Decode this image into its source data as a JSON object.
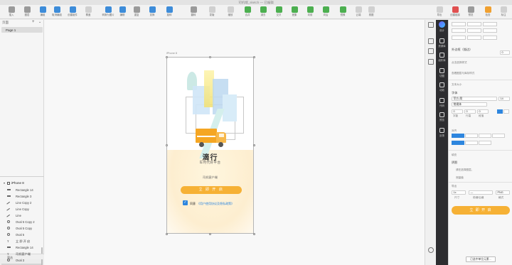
{
  "window": {
    "title": "司机端_sketch — 已编辑"
  },
  "toolbar": {
    "items": [
      {
        "label": "插入",
        "icon": "plus-icon",
        "color": "gray"
      },
      {
        "label": "图层",
        "icon": "layers-icon",
        "color": "gray"
      },
      {
        "label": "编组",
        "icon": "group-icon",
        "color": "blue"
      },
      {
        "label": "取消编组",
        "icon": "ungroup-icon",
        "color": "blue"
      },
      {
        "label": "创建组件",
        "icon": "symbol-icon",
        "color": "blue"
      },
      {
        "label": "覆盖",
        "icon": "override-icon",
        "color": "light"
      },
      {
        "label": "转换为图片",
        "icon": "image-icon",
        "color": "blue"
      },
      {
        "label": "编辑",
        "icon": "edit-icon",
        "color": "blue"
      },
      {
        "label": "重复",
        "icon": "repeat-icon",
        "color": "gray"
      },
      {
        "label": "变换",
        "icon": "transform-icon",
        "color": "blue"
      },
      {
        "label": "旋转",
        "icon": "rotate-icon",
        "color": "blue"
      },
      {
        "label": "翻转",
        "icon": "flip-icon",
        "color": "gray"
      },
      {
        "label": "蒙版",
        "icon": "mask-icon",
        "color": "light"
      },
      {
        "label": "缩放",
        "icon": "scale-icon",
        "color": "light"
      },
      {
        "label": "合并",
        "icon": "union-icon",
        "color": "green"
      },
      {
        "label": "减去",
        "icon": "subtract-icon",
        "color": "green"
      },
      {
        "label": "交叉",
        "icon": "intersect-icon",
        "color": "green"
      },
      {
        "label": "差集",
        "icon": "difference-icon",
        "color": "green"
      },
      {
        "label": "向前",
        "icon": "forward-icon",
        "color": "green"
      },
      {
        "label": "向后",
        "icon": "backward-icon",
        "color": "green"
      },
      {
        "label": "镜像",
        "icon": "mirror-icon",
        "color": "green"
      },
      {
        "label": "云端",
        "icon": "cloud-icon",
        "color": "light"
      },
      {
        "label": "视图",
        "icon": "view-icon",
        "color": "light"
      },
      {
        "label": "导出",
        "icon": "export-icon",
        "color": "light"
      },
      {
        "label": "创建链接",
        "icon": "link-icon",
        "color": "red"
      },
      {
        "label": "预览",
        "icon": "preview-icon",
        "color": "gray"
      },
      {
        "label": "检查",
        "icon": "inspect-icon",
        "color": "orange"
      },
      {
        "label": "标注",
        "icon": "annotate-icon",
        "color": "light"
      }
    ]
  },
  "left_panel": {
    "header": "页面",
    "pages": [
      "Page 1"
    ],
    "artboard": "iPhone 8",
    "layers": [
      {
        "name": "Rectangle 14",
        "kind": "rect"
      },
      {
        "name": "Rectangle 3",
        "kind": "rect"
      },
      {
        "name": "Line Copy 2",
        "kind": "line"
      },
      {
        "name": "Line Copy",
        "kind": "line"
      },
      {
        "name": "Line",
        "kind": "line"
      },
      {
        "name": "Oval 5 Copy 2",
        "kind": "oval"
      },
      {
        "name": "Oval 5 Copy",
        "kind": "oval"
      },
      {
        "name": "Oval 5",
        "kind": "oval"
      },
      {
        "name": "立 即 开 启",
        "kind": "txt"
      },
      {
        "name": "Rectangle 14",
        "kind": "rect"
      },
      {
        "name": "司机客户端",
        "kind": "txt"
      },
      {
        "name": "Oval 3",
        "kind": "oval"
      },
      {
        "name": "Path 3",
        "kind": "path"
      },
      {
        "name": "Group 2",
        "kind": "grp"
      }
    ],
    "footer": "筛选"
  },
  "canvas": {
    "artboard_label": "iPhone 8",
    "brand_title": "滴行",
    "brand_subtitle": "车时代好平台",
    "driver_text": "司机客户端",
    "cta_label": "立 即 开 启",
    "agree_label": "同意",
    "agree_link": "《用户使用协议及隐私政策》"
  },
  "inspector": {
    "section1": "外边框（描边）",
    "value1": "0",
    "choose_label": "点击选择样式",
    "sync_label": "查看图层与库存样式",
    "text_section": "文本大小",
    "font_label": "字体",
    "font_name": "苹方-简",
    "font_size": "14",
    "weight": "常规体",
    "spacing_labels": [
      "字距",
      "行高",
      "段落"
    ],
    "spacing_values": [
      "0",
      "0",
      "0"
    ],
    "align_label": "对齐",
    "fill_label": "填充",
    "shadow_label": "阴影",
    "shadow_choose": "请在选择图层。",
    "shadow_val": "测量值",
    "export_label": "导出",
    "export_scale": "1x",
    "export_suffix": "—",
    "export_format": "PNG",
    "export_labels": [
      "尺寸",
      "前缀/后缀",
      "格式"
    ],
    "cta_preview": "立 即 开 启",
    "footer_button": "已选中单位元素..."
  },
  "dark_sidebar": [
    {
      "label": "设计",
      "icon": "logo-icon"
    },
    {
      "label": "资源库",
      "icon": "library-icon"
    },
    {
      "label": "组件库",
      "icon": "components-icon"
    },
    {
      "label": "切图",
      "icon": "slice-icon"
    },
    {
      "label": "动效",
      "icon": "motion-icon"
    },
    {
      "label": "代码",
      "icon": "code-icon"
    },
    {
      "label": "预览",
      "icon": "preview-eye-icon"
    },
    {
      "label": "反馈",
      "icon": "feedback-icon"
    }
  ],
  "colors": {
    "accent": "#2e86de",
    "cta": "#f6b135",
    "dark": "#2d2d30"
  }
}
